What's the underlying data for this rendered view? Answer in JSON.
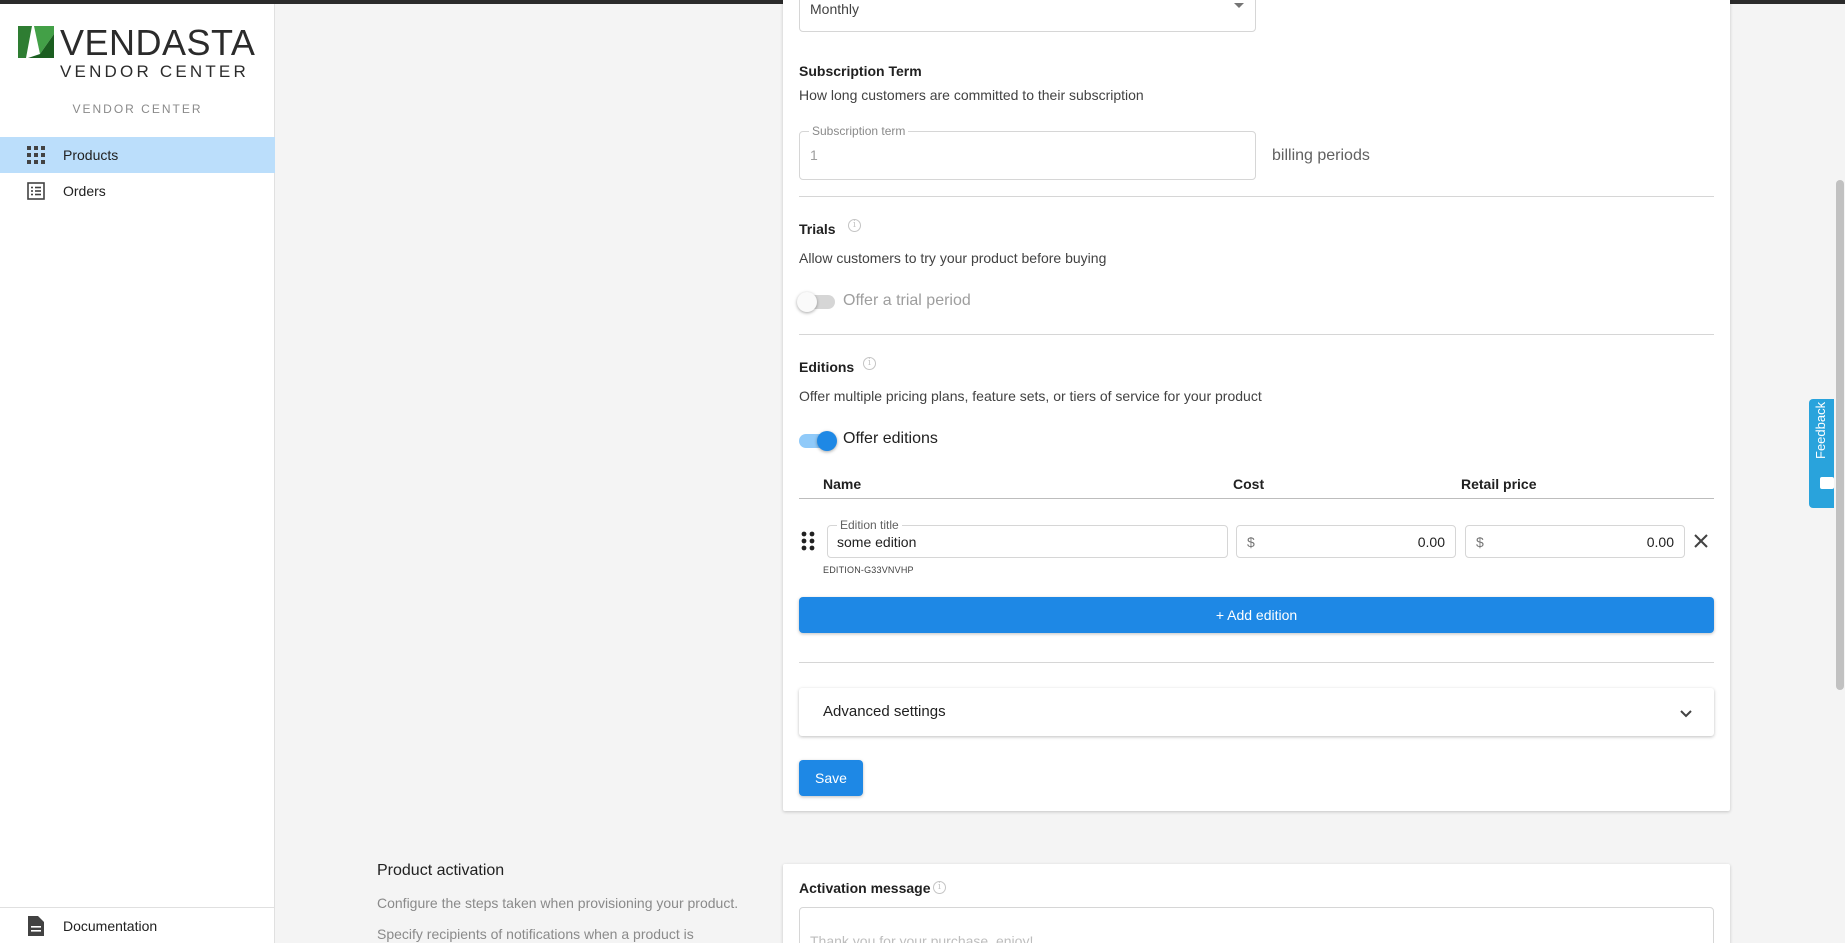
{
  "sidebar": {
    "logo_word": "VENDASTA",
    "logo_sub": "VENDOR CENTER",
    "app_label": "VENDOR CENTER",
    "items": [
      {
        "label": "Products",
        "icon": "grid-icon",
        "active": true
      },
      {
        "label": "Orders",
        "icon": "list-icon",
        "active": false
      }
    ],
    "footer": {
      "label": "Documentation",
      "icon": "document-icon"
    }
  },
  "billing": {
    "frequency_value": "Monthly"
  },
  "subscription_term": {
    "heading": "Subscription Term",
    "description": "How long customers are committed to their subscription",
    "field_label": "Subscription term",
    "field_value": "1",
    "suffix": "billing periods"
  },
  "trials": {
    "heading": "Trials",
    "description": "Allow customers to try your product before buying",
    "toggle_label": "Offer a trial period",
    "enabled": false
  },
  "editions": {
    "heading": "Editions",
    "description": "Offer multiple pricing plans, feature sets, or tiers of service for your product",
    "toggle_label": "Offer editions",
    "enabled": true,
    "columns": {
      "name": "Name",
      "cost": "Cost",
      "retail": "Retail price"
    },
    "rows": [
      {
        "title_label": "Edition title",
        "title": "some edition",
        "currency": "$",
        "cost": "0.00",
        "retail": "0.00",
        "edition_id": "EDITION-G33VNVHP"
      }
    ],
    "add_label": "+ Add edition"
  },
  "advanced": {
    "label": "Advanced settings"
  },
  "save_label": "Save",
  "activation": {
    "section_title": "Product activation",
    "section_desc_1": "Configure the steps taken when provisioning your product.",
    "section_desc_2": "Specify recipients of notifications when a product is",
    "message_heading": "Activation message",
    "message_placeholder": "Thank you for your purchase, enjoy!"
  },
  "feedback_label": "Feedback",
  "colors": {
    "accent": "#1e88e5",
    "nav_active": "#bbdefb",
    "feedback": "#29a3dc",
    "logo_green": "#2e7d32"
  }
}
